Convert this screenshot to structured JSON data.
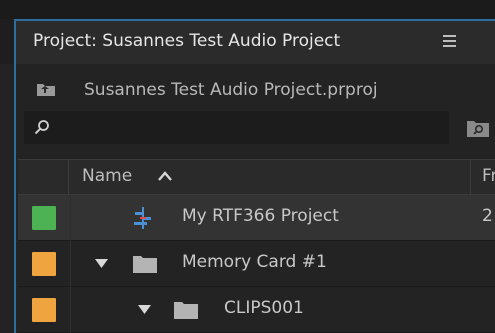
{
  "panel": {
    "tab_title": "Project: Susannes Test Audio Project",
    "tab_menu_icon": "hamburger-icon",
    "project_file": "Susannes Test Audio Project.prproj",
    "search": {
      "value": "",
      "placeholder": ""
    }
  },
  "columns": {
    "name": "Name",
    "frame_rate": "Fr",
    "sort": "ascending"
  },
  "rows": [
    {
      "name": "My RTF366 Project",
      "type": "sequence",
      "label_color": "#4cb253",
      "frame_rate": "2",
      "selected": true
    },
    {
      "name": "Memory Card #1",
      "type": "folder",
      "label_color": "#f0a440",
      "expanded": true
    },
    {
      "name": "CLIPS001",
      "type": "folder",
      "label_color": "#f0a440",
      "expanded": true
    }
  ],
  "colors": {
    "accent_border": "#2f6d9d",
    "panel_bg": "#232323"
  }
}
